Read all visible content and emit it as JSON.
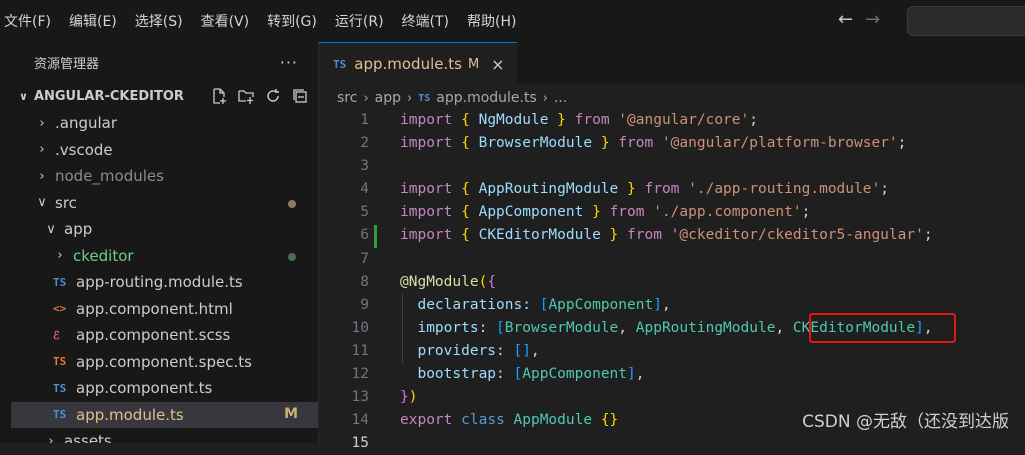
{
  "menu": [
    "文件(F)",
    "编辑(E)",
    "选择(S)",
    "查看(V)",
    "转到(G)",
    "运行(R)",
    "终端(T)",
    "帮助(H)"
  ],
  "sidebar": {
    "title": "资源管理器",
    "more": "···",
    "project": "ANGULAR-CKEDITOR",
    "items": [
      {
        "label": ".angular",
        "type": "folder",
        "expanded": false,
        "depth": 0
      },
      {
        "label": ".vscode",
        "type": "folder",
        "expanded": false,
        "depth": 0
      },
      {
        "label": "node_modules",
        "type": "folder",
        "expanded": false,
        "depth": 0,
        "dim": true
      },
      {
        "label": "src",
        "type": "folder",
        "expanded": true,
        "depth": 0,
        "dot": "modified"
      },
      {
        "label": "app",
        "type": "folder",
        "expanded": true,
        "depth": 1
      },
      {
        "label": "ckeditor",
        "type": "folder",
        "expanded": false,
        "depth": 2,
        "color": "#73c991",
        "dot": "untracked"
      },
      {
        "label": "app-routing.module.ts",
        "type": "ts",
        "icon": "TS",
        "iconColor": "#4a90d9",
        "depth": 2
      },
      {
        "label": "app.component.html",
        "type": "html",
        "icon": "<>",
        "iconColor": "#e37933",
        "depth": 2
      },
      {
        "label": "app.component.scss",
        "type": "scss",
        "icon": "ℰ",
        "iconColor": "#f55385",
        "depth": 2
      },
      {
        "label": "app.component.spec.ts",
        "type": "spec",
        "icon": "TS",
        "iconColor": "#e37933",
        "depth": 2
      },
      {
        "label": "app.component.ts",
        "type": "ts",
        "icon": "TS",
        "iconColor": "#4a90d9",
        "depth": 2
      },
      {
        "label": "app.module.ts",
        "type": "ts",
        "icon": "TS",
        "iconColor": "#4a90d9",
        "depth": 2,
        "selected": true,
        "badge": "M",
        "color": "#e2c08d"
      },
      {
        "label": "assets",
        "type": "folder",
        "expanded": false,
        "depth": 1
      }
    ]
  },
  "tab": {
    "icon": "TS",
    "label": "app.module.ts",
    "status": "M",
    "close": "×"
  },
  "breadcrumb": {
    "parts": [
      "src",
      "app"
    ],
    "file_icon": "TS",
    "file": "app.module.ts",
    "tail": "..."
  },
  "code": {
    "line_numbers": [
      "1",
      "2",
      "3",
      "4",
      "5",
      "6",
      "7",
      "8",
      "9",
      "10",
      "11",
      "12",
      "13",
      "14",
      "15"
    ],
    "highlighted": "CKEditorModule"
  },
  "watermark": "CSDN @无敌（还没到达版",
  "colors": {
    "accent": "#0078d4",
    "highlight_box": "#e01818",
    "modified": "#e2c08d",
    "untracked": "#73c991"
  }
}
